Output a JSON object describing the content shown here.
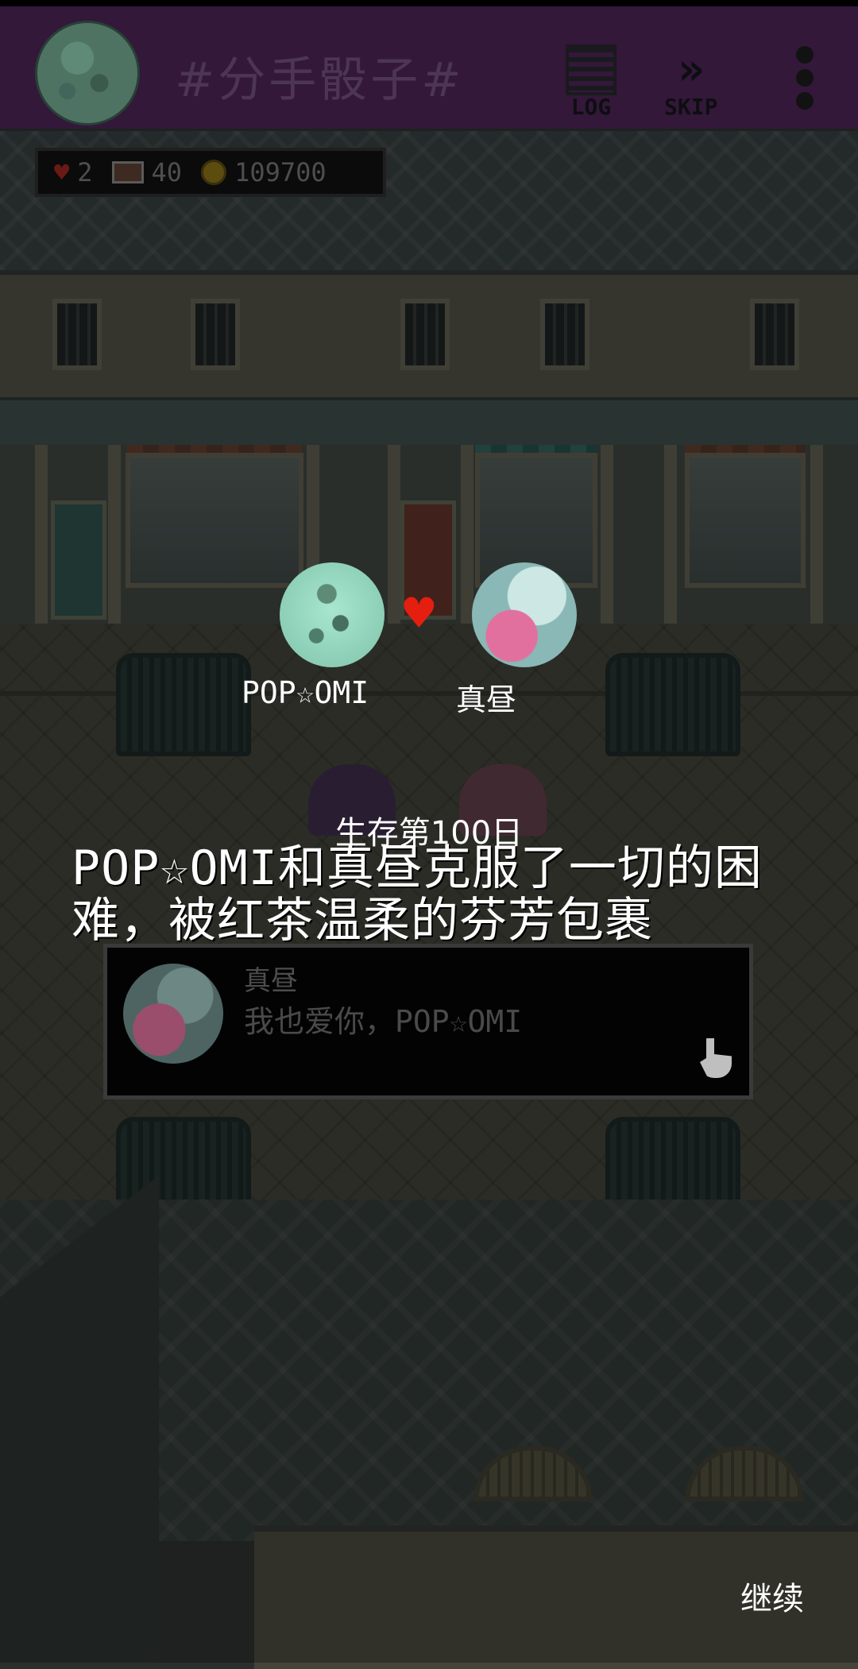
{
  "header": {
    "title": "#分手骰子#",
    "log_label": "LOG",
    "skip_label": "SKIP",
    "avatar_icon": "green-moon-avatar",
    "menu_icon": "vertical-dots-icon"
  },
  "resources": {
    "hearts": "2",
    "items": "40",
    "coins": "109700"
  },
  "couple": {
    "player_name": "POP☆OMI",
    "partner_name": "真昼",
    "heart_icon": "heart-icon",
    "heart_color": "#e41f10"
  },
  "story": {
    "day": "生存第100日",
    "text": "POP☆OMI和真昼克服了一切的困难，被红茶温柔的芬芳包裹"
  },
  "dialog": {
    "speaker": "真昼",
    "line": "我也爱你，POP☆OMI"
  },
  "footer": {
    "continue_label": "继续"
  },
  "colors": {
    "topbar": "#33183a",
    "title": "#4d3556"
  }
}
